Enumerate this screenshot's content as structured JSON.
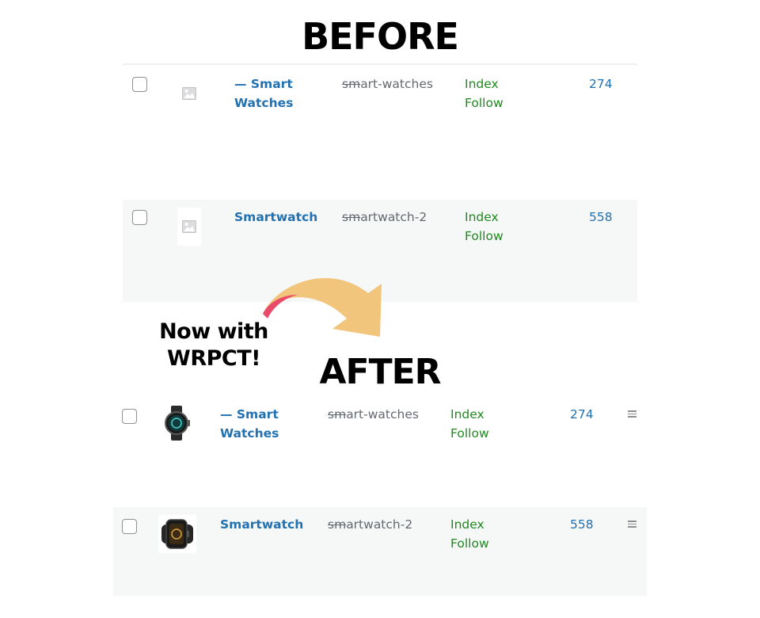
{
  "headings": {
    "before": "BEFORE",
    "after": "AFTER"
  },
  "caption": {
    "line1": "Now with",
    "line2": "WRPCT!"
  },
  "before_rows": [
    {
      "name_line1": "— Smart",
      "name_line2": "Watches",
      "slug_prefix": "sm",
      "slug_rest": "art-watches",
      "robots_line1": "Index",
      "robots_line2": "Follow",
      "count": "274",
      "thumbnail": "placeholder-image-icon"
    },
    {
      "name_line1": "Smartwatch",
      "name_line2": "",
      "slug_prefix": "sm",
      "slug_rest": "artwatch-2",
      "robots_line1": "Index",
      "robots_line2": "Follow",
      "count": "558",
      "thumbnail": "placeholder-image-icon"
    }
  ],
  "after_rows": [
    {
      "name_line1": "— Smart",
      "name_line2": "Watches",
      "slug_prefix": "sm",
      "slug_rest": "art-watches",
      "robots_line1": "Index",
      "robots_line2": "Follow",
      "count": "274",
      "thumbnail": "round-smartwatch-image"
    },
    {
      "name_line1": "Smartwatch",
      "name_line2": "",
      "slug_prefix": "sm",
      "slug_rest": "artwatch-2",
      "robots_line1": "Index",
      "robots_line2": "Follow",
      "count": "558",
      "thumbnail": "square-smartwatch-image"
    }
  ],
  "icons": {
    "drag_handle": "drag-handle-icon",
    "arrow": "curved-arrow-icon"
  },
  "colors": {
    "link": "#2271b1",
    "robots": "#1e8a1e",
    "slug": "#646970",
    "alt_row": "#f6f7f7",
    "arrow_body": "#f2c57c",
    "arrow_tail": "#e94c6a"
  }
}
